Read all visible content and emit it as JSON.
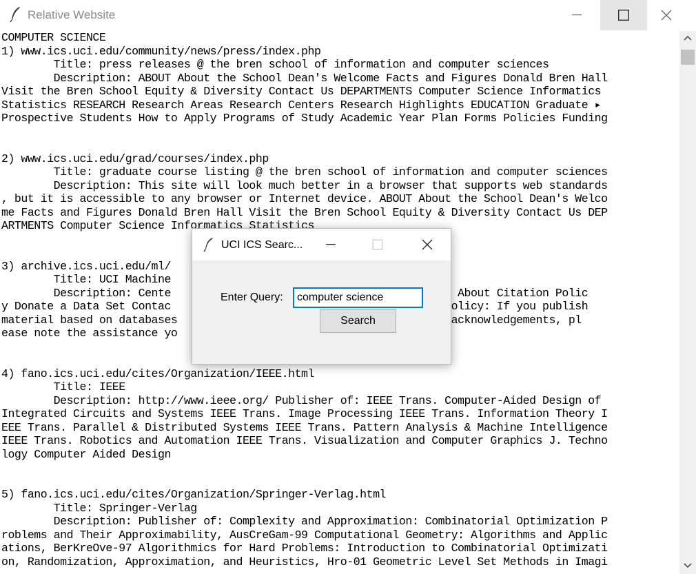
{
  "window": {
    "title": "Relative Website"
  },
  "results_lines": [
    "COMPUTER SCIENCE",
    "1) www.ics.uci.edu/community/news/press/index.php",
    "        Title: press releases @ the bren school of information and computer sciences",
    "        Description: ABOUT About the School Dean's Welcome Facts and Figures Donald Bren Hall",
    "Visit the Bren School Equity & Diversity Contact Us DEPARTMENTS Computer Science Informatics",
    "Statistics RESEARCH Research Areas Research Centers Research Highlights EDUCATION Graduate ▸",
    "Prospective Students How to Apply Programs of Study Academic Year Plan Forms Policies Funding",
    "",
    "",
    "2) www.ics.uci.edu/grad/courses/index.php",
    "        Title: graduate course listing @ the bren school of information and computer sciences",
    "        Description: This site will look much better in a browser that supports web standards",
    ", but it is accessible to any browser or Internet device. ABOUT About the School Dean's Welco",
    "me Facts and Figures Donald Bren Hall Visit the Bren School Equity & Diversity Contact Us DEP",
    "ARTMENTS Computer Science Informatics Statistics",
    "",
    "",
    "3) archive.ics.uci.edu/ml/",
    "        Title: UCI Machine                                y",
    "        Description: Cente                                 nt Systems About Citation Polic",
    "y Donate a Data Set Contac                                 Citation Policy: If you publish",
    "material based on databases                               n, in your acknowledgements, pl",
    "ease note the assistance yo                               . This will",
    "",
    "",
    "4) fano.ics.uci.edu/cites/Organization/IEEE.html",
    "        Title: IEEE",
    "        Description: http://www.ieee.org/ Publisher of: IEEE Trans. Computer-Aided Design of",
    "Integrated Circuits and Systems IEEE Trans. Image Processing IEEE Trans. Information Theory I",
    "EEE Trans. Parallel & Distributed Systems IEEE Trans. Pattern Analysis & Machine Intelligence",
    "IEEE Trans. Robotics and Automation IEEE Trans. Visualization and Computer Graphics J. Techno",
    "logy Computer Aided Design",
    "",
    "",
    "5) fano.ics.uci.edu/cites/Organization/Springer-Verlag.html",
    "        Title: Springer-Verlag",
    "        Description: Publisher of: Complexity and Approximation: Combinatorial Optimization P",
    "roblems and Their Approximability, AusCreGam-99 Computational Geometry: Algorithms and Applic",
    "ations, BerKreOve-97 Algorithmics for Hard Problems: Introduction to Combinatorial Optimizati",
    "on, Randomization, Approximation, and Heuristics, Hro-01 Geometric Level Set Methods in Imagi"
  ],
  "dialog": {
    "title": "UCI ICS Searc...",
    "query_label": "Enter Query:",
    "query_value": "computer science",
    "search_button": "Search"
  },
  "icons": {
    "app": "feather-icon",
    "minimize": "minimize-icon",
    "maximize": "maximize-icon",
    "close": "close-icon",
    "scroll_up": "chevron-up-icon",
    "scroll_down": "chevron-down-icon"
  },
  "colors": {
    "accent": "#0078d7",
    "dialog_bg": "#f0f0f0",
    "title_text": "#8a8a8a"
  }
}
